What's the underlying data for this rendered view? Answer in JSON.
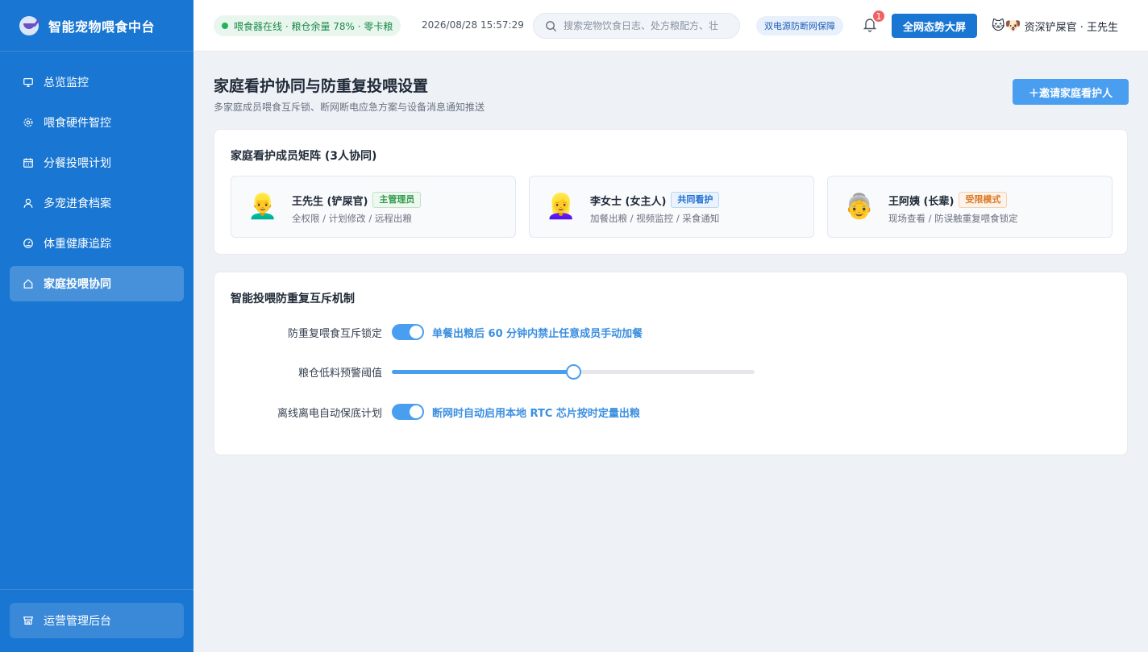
{
  "app": {
    "title": "智能宠物喂食中台"
  },
  "sidebar": {
    "items": [
      {
        "label": "总览监控",
        "icon": "monitor-icon"
      },
      {
        "label": "喂食硬件智控",
        "icon": "gear-icon"
      },
      {
        "label": "分餐投喂计划",
        "icon": "calendar-icon"
      },
      {
        "label": "多宠进食档案",
        "icon": "user-icon"
      },
      {
        "label": "体重健康追踪",
        "icon": "gauge-icon"
      },
      {
        "label": "家庭投喂协同",
        "icon": "home-icon",
        "active": true
      }
    ],
    "admin_label": "运营管理后台"
  },
  "header": {
    "status": "喂食器在线 · 粮仓余量 78% · 零卡粮",
    "datetime": "2026/08/28 15:57:29",
    "search_placeholder": "搜索宠物饮食日志、处方粮配方、壮",
    "power_badge": "双电源防断网保障",
    "notification_count": "1",
    "big_screen_label": "全网态势大屏",
    "user_emojis": "🐱🐶",
    "user_name": "资深铲屎官 · 王先生"
  },
  "page": {
    "title": "家庭看护协同与防重复投喂设置",
    "subtitle": "多家庭成员喂食互斥锁、断网断电应急方案与设备消息通知推送",
    "invite_label": "＋邀请家庭看护人"
  },
  "members_card": {
    "title": "家庭看护成员矩阵 (3人协同)",
    "members": [
      {
        "emoji": "👱‍♂️",
        "name": "王先生 (铲屎官)",
        "tag": "主管理员",
        "tag_color": "green",
        "desc": "全权限 / 计划修改 / 远程出粮"
      },
      {
        "emoji": "👱‍♀️",
        "name": "李女士 (女主人)",
        "tag": "共同看护",
        "tag_color": "blue",
        "desc": "加餐出粮 / 视频监控 / 采食通知"
      },
      {
        "emoji": "👵",
        "name": "王阿姨 (长辈)",
        "tag": "受限模式",
        "tag_color": "orange",
        "desc": "现场查看 / 防误触重复喂食锁定"
      }
    ]
  },
  "mutex_card": {
    "title": "智能投喂防重复互斥机制",
    "settings": {
      "lock": {
        "label": "防重复喂食互斥锁定",
        "enabled": true,
        "note": "单餐出粮后 60 分钟内禁止任意成员手动加餐"
      },
      "threshold": {
        "label": "粮仓低料预警阈值",
        "value_percent": 50
      },
      "offline": {
        "label": "离线离电自动保底计划",
        "enabled": true,
        "note": "断网时自动启用本地 RTC 芯片按时定量出粮"
      }
    }
  },
  "colors": {
    "primary": "#1976d2",
    "accent": "#4a9ef0",
    "online_green": "#22b35a",
    "badge_red": "#f06262"
  }
}
